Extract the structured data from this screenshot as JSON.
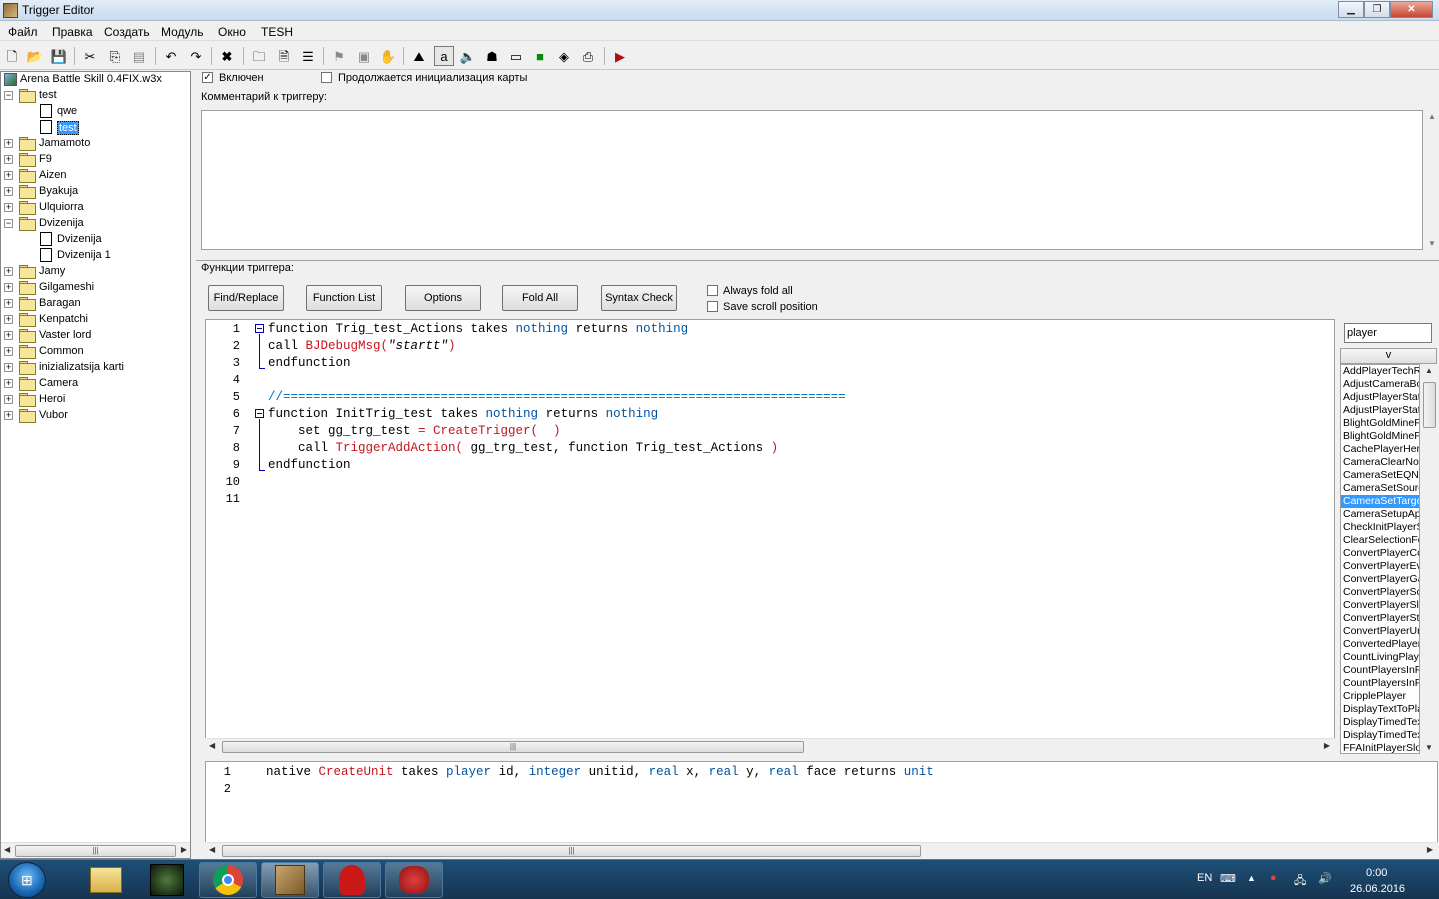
{
  "window": {
    "title": "Trigger Editor"
  },
  "menu": [
    "Файл",
    "Правка",
    "Создать",
    "Модуль",
    "Окно",
    "TESH"
  ],
  "tree": {
    "root": "Arena Battle Skill 0.4FIX.w3x",
    "items": [
      {
        "label": "test",
        "level": 1,
        "type": "folder",
        "expanded": true
      },
      {
        "label": "qwe",
        "level": 2,
        "type": "trigger"
      },
      {
        "label": "test",
        "level": 2,
        "type": "trigger",
        "selected": true
      },
      {
        "label": "Jamamoto",
        "level": 1,
        "type": "folder"
      },
      {
        "label": "F9",
        "level": 1,
        "type": "folder"
      },
      {
        "label": "Aizen",
        "level": 1,
        "type": "folder"
      },
      {
        "label": "Byakuja",
        "level": 1,
        "type": "folder"
      },
      {
        "label": "Ulquiorra",
        "level": 1,
        "type": "folder"
      },
      {
        "label": "Dvizenija",
        "level": 1,
        "type": "folder",
        "expanded": true
      },
      {
        "label": "Dvizenija",
        "level": 2,
        "type": "trigger"
      },
      {
        "label": "Dvizenija 1",
        "level": 2,
        "type": "trigger"
      },
      {
        "label": "Jamy",
        "level": 1,
        "type": "folder"
      },
      {
        "label": "Gilgameshi",
        "level": 1,
        "type": "folder"
      },
      {
        "label": "Baragan",
        "level": 1,
        "type": "folder"
      },
      {
        "label": "Kenpatchi",
        "level": 1,
        "type": "folder"
      },
      {
        "label": "Vaster lord",
        "level": 1,
        "type": "folder"
      },
      {
        "label": "Common",
        "level": 1,
        "type": "folder"
      },
      {
        "label": "inizializatsija karti",
        "level": 1,
        "type": "folder"
      },
      {
        "label": "Camera",
        "level": 1,
        "type": "folder"
      },
      {
        "label": "Heroi",
        "level": 1,
        "type": "folder"
      },
      {
        "label": "Vubor",
        "level": 1,
        "type": "folder"
      }
    ]
  },
  "trigger": {
    "enabled_label": "Включен",
    "enabled": true,
    "init_label": "Продолжается инициализация карты",
    "init_checked": false,
    "comment_label": "Комментарий к триггеру:",
    "functions_label": "Функции триггера:"
  },
  "editor_toolbar": {
    "find_replace": "Find/Replace",
    "function_list": "Function List",
    "options": "Options",
    "fold_all": "Fold All",
    "syntax_check": "Syntax Check",
    "always_fold_all": "Always fold all",
    "save_scroll": "Save scroll position"
  },
  "code": {
    "line_numbers": [
      "1",
      "2",
      "3",
      "4",
      "5",
      "6",
      "7",
      "8",
      "9",
      "10",
      "11"
    ],
    "lines": [
      [
        {
          "t": "kw",
          "v": "function Trig_test_Actions takes "
        },
        {
          "t": "ty",
          "v": "nothing"
        },
        {
          "t": "kw",
          "v": " returns "
        },
        {
          "t": "ty",
          "v": "nothing"
        }
      ],
      [
        {
          "t": "kw",
          "v": "call "
        },
        {
          "t": "fn",
          "v": "BJDebugMsg("
        },
        {
          "t": "st",
          "v": "\"startt\""
        },
        {
          "t": "fn",
          "v": ")"
        }
      ],
      [
        {
          "t": "kw",
          "v": "endfunction"
        }
      ],
      [],
      [
        {
          "t": "cm",
          "v": "//==========================================================================="
        }
      ],
      [
        {
          "t": "kw",
          "v": "function InitTrig_test takes "
        },
        {
          "t": "ty",
          "v": "nothing"
        },
        {
          "t": "kw",
          "v": " returns "
        },
        {
          "t": "ty",
          "v": "nothing"
        }
      ],
      [
        {
          "t": "kw",
          "v": "    set gg_trg_test "
        },
        {
          "t": "fn",
          "v": "= CreateTrigger(  )"
        }
      ],
      [
        {
          "t": "kw",
          "v": "    call "
        },
        {
          "t": "fn",
          "v": "TriggerAddAction("
        },
        {
          "t": "kw",
          "v": " gg_trg_test, function Trig_test_Actions "
        },
        {
          "t": "fn",
          "v": ")"
        }
      ],
      [
        {
          "t": "kw",
          "v": "endfunction"
        }
      ],
      [],
      []
    ]
  },
  "function_search": {
    "value": "player",
    "sort_label": "v"
  },
  "function_list": [
    "AddPlayerTechResearched",
    "AdjustCameraBoundsForPlayer",
    "AdjustPlayerStateBJ",
    "AdjustPlayerStateSimpleBJ",
    "BlightGoldMineForPlayer",
    "BlightGoldMineForPlayerBJ",
    "CachePlayerHeroData",
    "CameraClearNoiseForPlayer",
    "CameraSetEQNoiseForPlayer",
    "CameraSetSourceNoiseForPlayer",
    "CameraSetTargetNoiseForPlayer",
    "CameraSetupApplyForPlayer",
    "CheckInitPlayerSlotAvailability",
    "ClearSelectionForPlayer",
    "ConvertPlayerColor",
    "ConvertPlayerEvent",
    "ConvertPlayerGameResult",
    "ConvertPlayerScore",
    "ConvertPlayerSlotState",
    "ConvertPlayerState",
    "ConvertPlayerUnitEvent",
    "ConvertedPlayer",
    "CountLivingPlayerUnitsOfTypeId",
    "CountPlayersInForceBJ",
    "CountPlayersInForceEnum",
    "CripplePlayer",
    "DisplayTextToPlayer",
    "DisplayTimedTextFromPlayer",
    "DisplayTimedTextToPlayer",
    "FFAInitPlayerSlots"
  ],
  "function_selected_index": 10,
  "signature": {
    "line_numbers": [
      "1",
      "2"
    ],
    "tokens": [
      {
        "t": "kw",
        "v": "native "
      },
      {
        "t": "fn",
        "v": "CreateUnit"
      },
      {
        "t": "kw",
        "v": " takes "
      },
      {
        "t": "ty",
        "v": "player"
      },
      {
        "t": "kw",
        "v": " id, "
      },
      {
        "t": "ty",
        "v": "integer"
      },
      {
        "t": "kw",
        "v": " unitid, "
      },
      {
        "t": "ty",
        "v": "real"
      },
      {
        "t": "kw",
        "v": " x, "
      },
      {
        "t": "ty",
        "v": "real"
      },
      {
        "t": "kw",
        "v": " y, "
      },
      {
        "t": "ty",
        "v": "real"
      },
      {
        "t": "kw",
        "v": " face returns "
      },
      {
        "t": "ty",
        "v": "unit"
      }
    ]
  },
  "taskbar": {
    "lang": "EN",
    "time": "0:00",
    "date": "26.06.2016"
  },
  "colors": {
    "selection": "#3399ff",
    "keyword_type": "#0052a3",
    "native_fn": "#c8141e",
    "comment": "#0070c0"
  }
}
